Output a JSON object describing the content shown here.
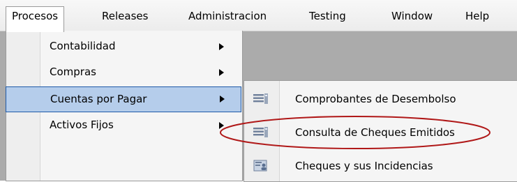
{
  "menubar": {
    "items": [
      {
        "label": "Procesos"
      },
      {
        "label": "Releases"
      },
      {
        "label": "Administracion"
      },
      {
        "label": "Testing"
      },
      {
        "label": "Window"
      },
      {
        "label": "Help"
      }
    ]
  },
  "procesos_menu": {
    "items": [
      {
        "label": "Contabilidad"
      },
      {
        "label": "Compras"
      },
      {
        "label": "Cuentas por Pagar",
        "highlighted": true
      },
      {
        "label": "Activos Fijos"
      }
    ]
  },
  "cuentas_submenu": {
    "items": [
      {
        "label": "Comprobantes de Desembolso",
        "icon": "list-icon"
      },
      {
        "label": "Consulta de Cheques Emitidos",
        "icon": "list-icon",
        "circled": true
      },
      {
        "label": "Cheques y sus Incidencias",
        "icon": "document-user-icon"
      }
    ]
  },
  "colors": {
    "highlight": "#b5cdeb",
    "highlight_border": "#1e5aa8",
    "annotation": "#b01818",
    "workspace": "#ababab"
  }
}
